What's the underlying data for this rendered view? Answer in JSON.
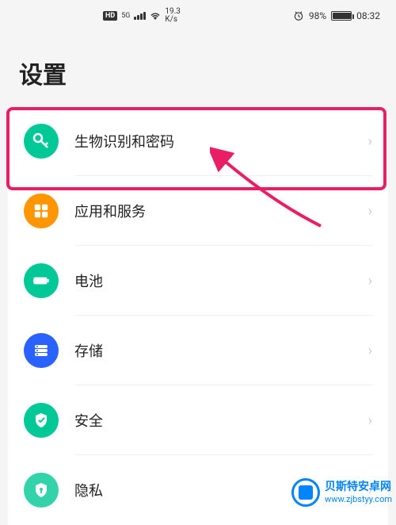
{
  "statusBar": {
    "hd": "HD",
    "network": "5G",
    "speed": "19.3",
    "speedUnit": "K/s",
    "battery": "98%",
    "time": "08:32"
  },
  "page": {
    "title": "设置"
  },
  "settings": {
    "items": [
      {
        "label": "生物识别和密码",
        "iconName": "key-icon",
        "iconColor": "#00c896"
      },
      {
        "label": "应用和服务",
        "iconName": "apps-icon",
        "iconColor": "#ff9500"
      },
      {
        "label": "电池",
        "iconName": "battery-icon",
        "iconColor": "#00c896"
      },
      {
        "label": "存储",
        "iconName": "storage-icon",
        "iconColor": "#2962ff"
      },
      {
        "label": "安全",
        "iconName": "shield-icon",
        "iconColor": "#00c896"
      },
      {
        "label": "隐私",
        "iconName": "privacy-icon",
        "iconColor": "#00c896"
      }
    ]
  },
  "watermark": {
    "name": "贝斯特安卓网",
    "url": "www.zjbstyy.com"
  }
}
